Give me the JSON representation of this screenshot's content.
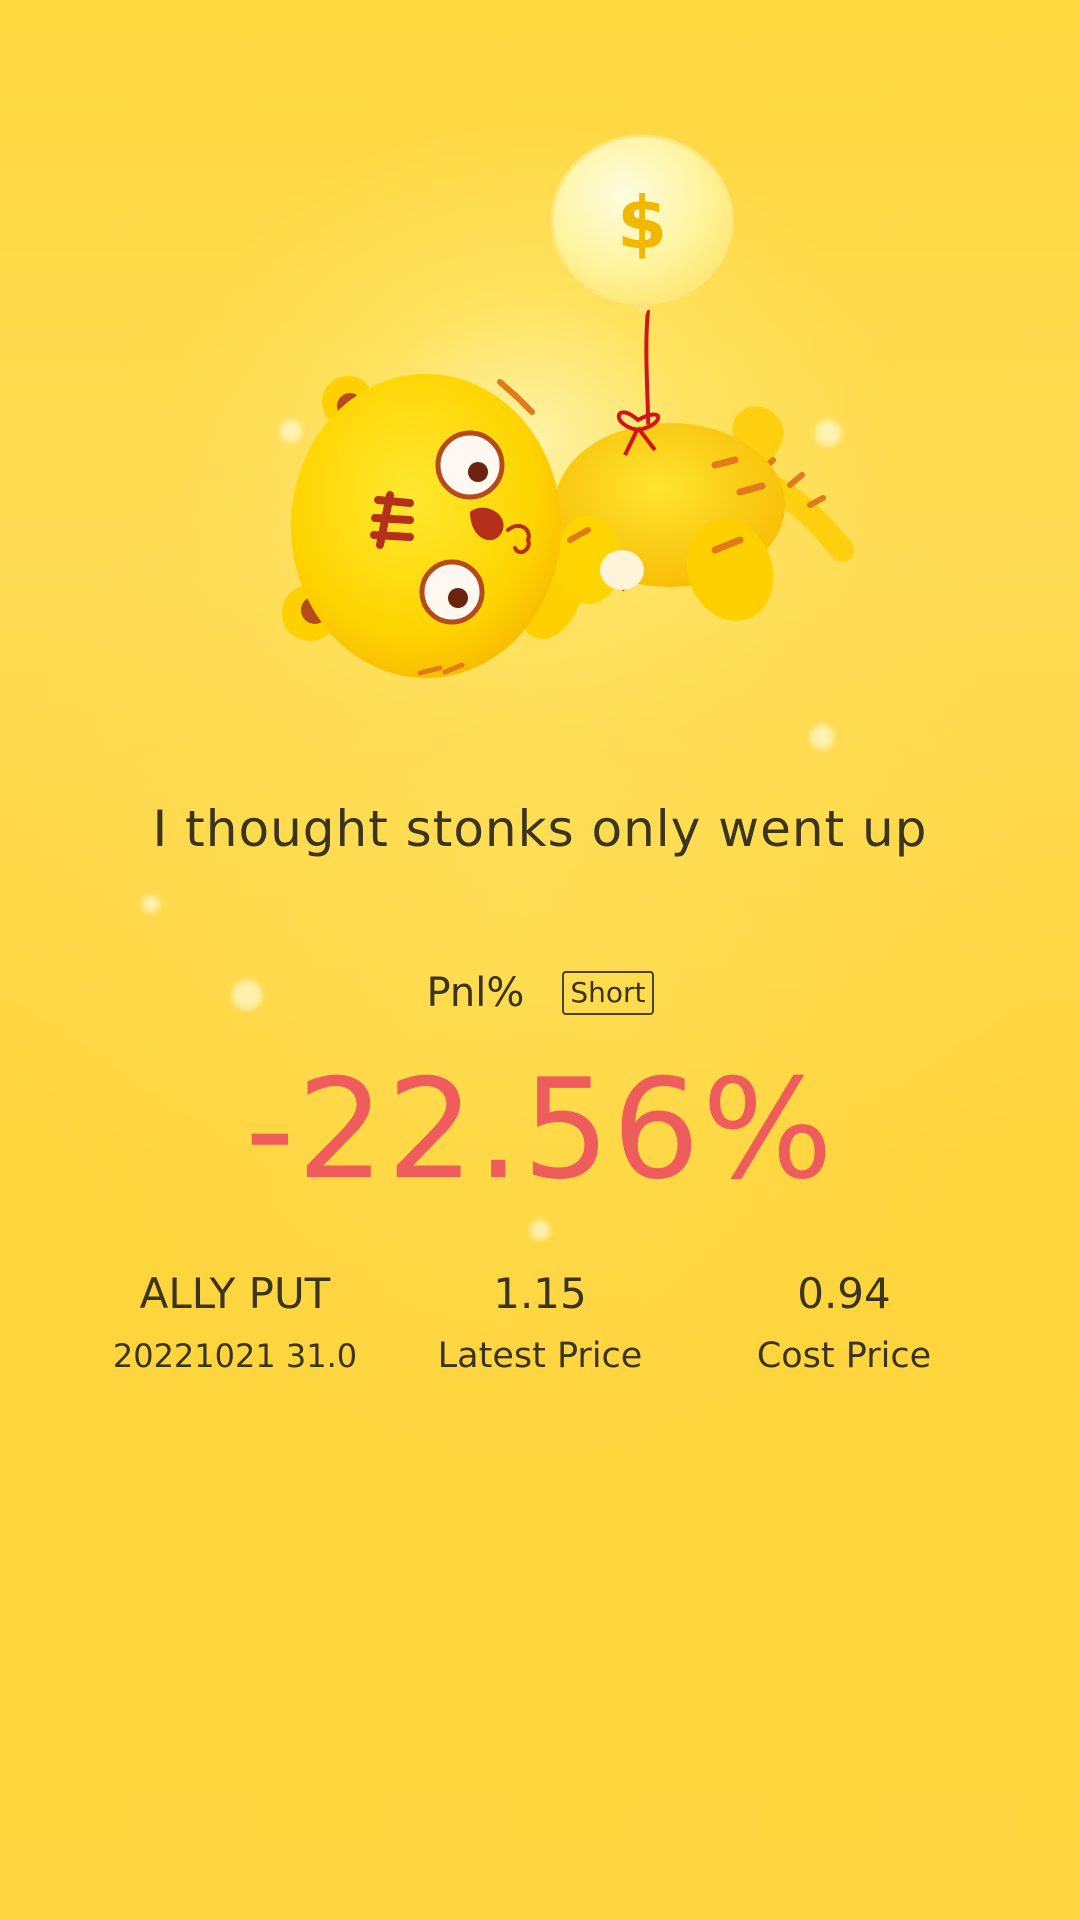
{
  "tagline": "I thought stonks only went up",
  "pnl": {
    "label": "Pnl%",
    "side": "Short",
    "value": "-22.56%",
    "value_color": "#ee5c5c"
  },
  "stats": {
    "symbol": "ALLY PUT",
    "contract": "20221021 31.0",
    "latest_price": "1.15",
    "latest_price_label": "Latest Price",
    "cost_price": "0.94",
    "cost_price_label": "Cost Price"
  },
  "illustration": {
    "icon": "tiger-balloon-illustration",
    "balloon_symbol": "$"
  },
  "colors": {
    "background": "#ffd83f",
    "text": "#3a3420",
    "loss": "#ee5c5c"
  }
}
